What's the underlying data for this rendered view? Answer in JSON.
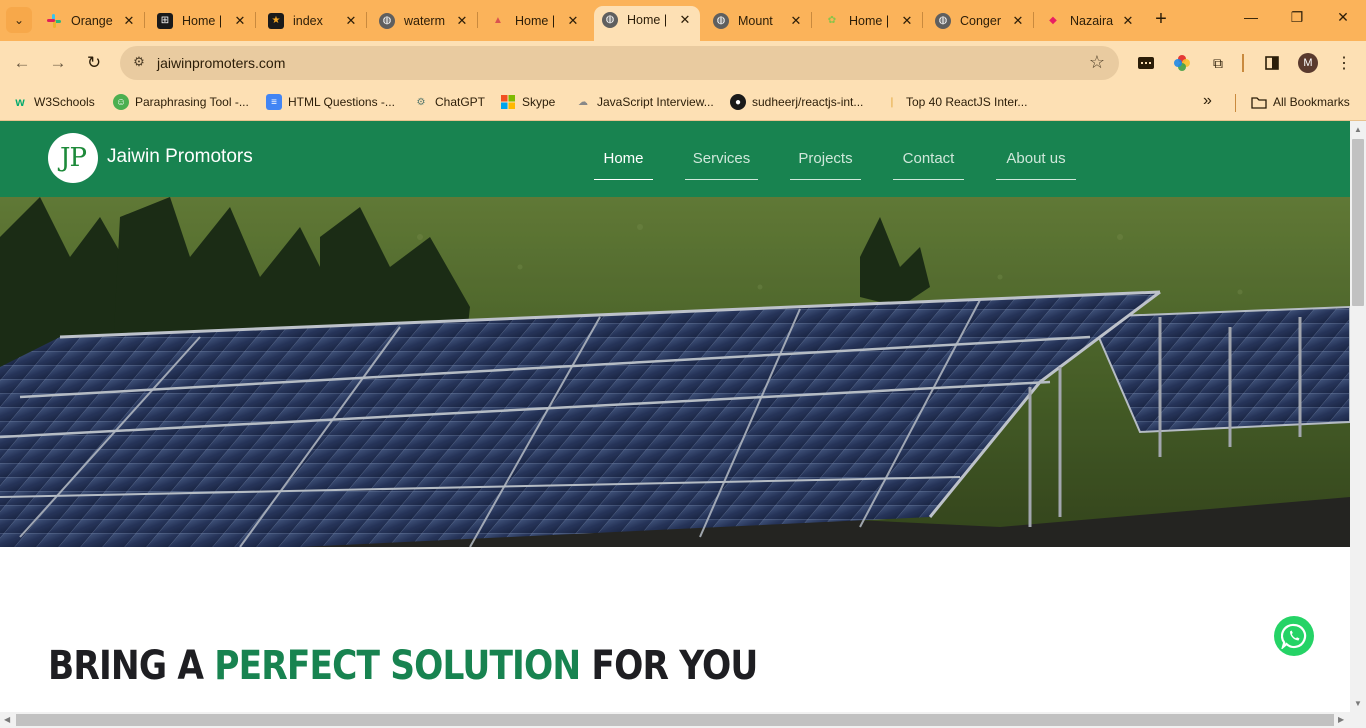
{
  "browser": {
    "tabs": [
      {
        "title": "Orange",
        "icon": "slack-icon"
      },
      {
        "title": "Home |",
        "icon": "generic-site-icon"
      },
      {
        "title": "index",
        "icon": "star-site-icon"
      },
      {
        "title": "waterm",
        "icon": "globe-icon"
      },
      {
        "title": "Home |",
        "icon": "pyramid-site-icon"
      },
      {
        "title": "Home |",
        "icon": "globe-icon",
        "active": true
      },
      {
        "title": "Mount",
        "icon": "globe-icon"
      },
      {
        "title": "Home |",
        "icon": "leaf-site-icon"
      },
      {
        "title": "Conger",
        "icon": "globe-icon"
      },
      {
        "title": "Nazaira",
        "icon": "diamond-site-icon"
      }
    ],
    "url": "jaiwinpromoters.com",
    "avatar_letter": "M",
    "bookmarks": [
      {
        "label": "W3Schools",
        "icon": "w3schools-icon"
      },
      {
        "label": "Paraphrasing Tool -...",
        "icon": "robot-icon"
      },
      {
        "label": "HTML Questions -...",
        "icon": "docs-icon"
      },
      {
        "label": "ChatGPT",
        "icon": "chatgpt-icon"
      },
      {
        "label": "Skype",
        "icon": "microsoft-icon"
      },
      {
        "label": "JavaScript Interview...",
        "icon": "cloud-icon"
      },
      {
        "label": "sudheerj/reactjs-int...",
        "icon": "github-icon"
      },
      {
        "label": "Top 40 ReactJS Inter...",
        "icon": "bookmark-icon"
      }
    ],
    "all_bookmarks": "All Bookmarks"
  },
  "site": {
    "logo": "JP",
    "brand": "Jaiwin Promotors",
    "nav": [
      {
        "label": "Home",
        "active": true
      },
      {
        "label": "Services"
      },
      {
        "label": "Projects"
      },
      {
        "label": "Contact"
      },
      {
        "label": "About us"
      }
    ],
    "headline": {
      "part1": "BRING A ",
      "highlight": "PERFECT SOLUTION",
      "part2": " FOR YOU"
    }
  },
  "colors": {
    "header_green": "#188350",
    "highlight_green": "#188350",
    "chrome_orange": "#fbb35a",
    "whatsapp_green": "#25d366"
  }
}
